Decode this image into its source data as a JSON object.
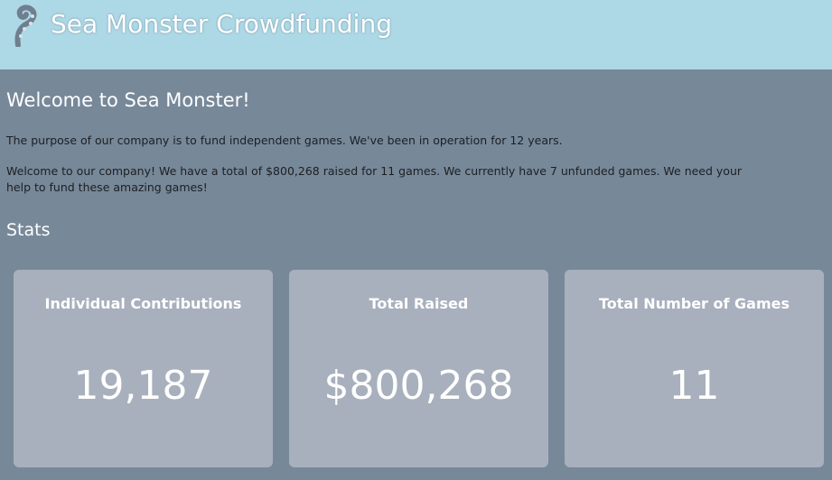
{
  "header": {
    "title": "Sea Monster Crowdfunding",
    "logo_icon": "tentacle-icon"
  },
  "main": {
    "welcome_heading": "Welcome to Sea Monster!",
    "intro_text": "The purpose of our company is to fund independent games. We've been in operation for 12 years.",
    "summary_text": "Welcome to our company! We have a total of $800,268 raised for 11 games. We currently have 7 unfunded games. We need your help to fund these amazing games!",
    "stats_heading": "Stats"
  },
  "stats": [
    {
      "label": "Individual Contributions",
      "value": "19,187"
    },
    {
      "label": "Total Raised",
      "value": "$800,268"
    },
    {
      "label": "Total Number of Games",
      "value": "11"
    }
  ],
  "colors": {
    "header_bg": "#add8e6",
    "page_bg": "#778899",
    "card_bg": "#a8b0bd"
  }
}
